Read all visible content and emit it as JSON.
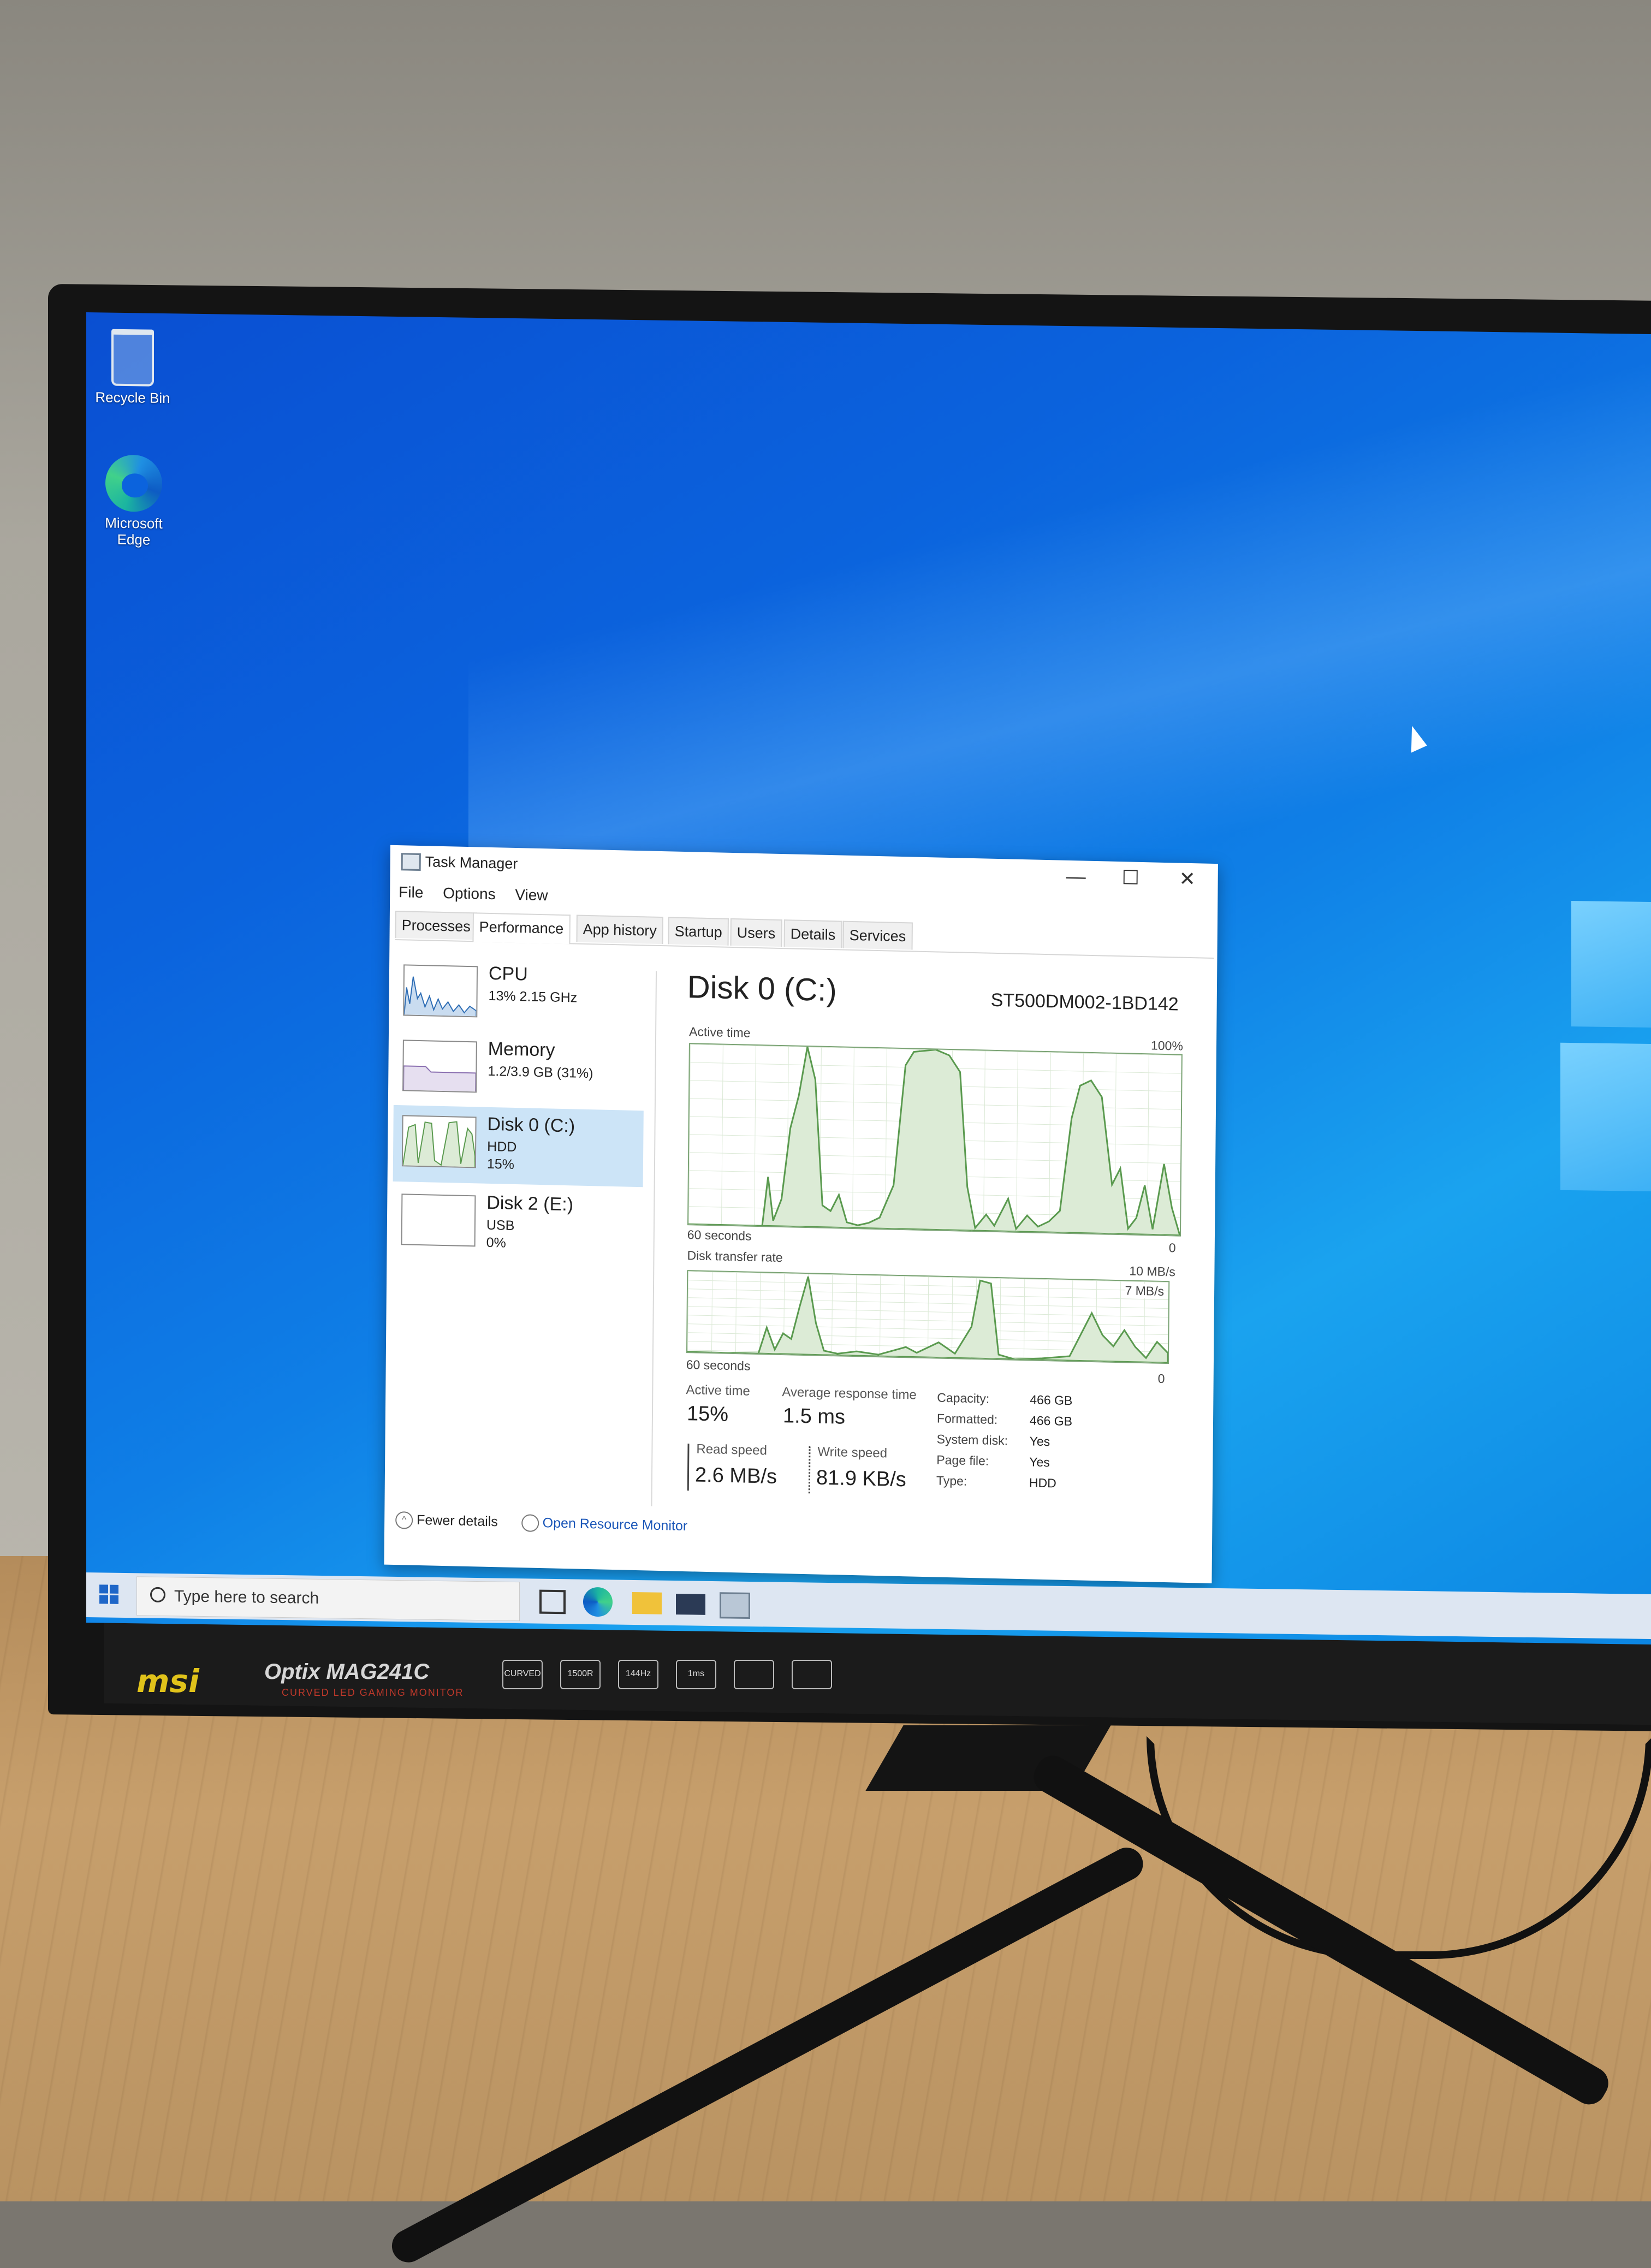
{
  "desktop": {
    "icons": [
      {
        "label": "Recycle Bin"
      },
      {
        "label": "Microsoft Edge"
      }
    ]
  },
  "task_manager": {
    "title": "Task Manager",
    "window_controls": {
      "minimize": "—",
      "maximize": "☐",
      "close": "✕"
    },
    "menu": [
      "File",
      "Options",
      "View"
    ],
    "tabs": [
      "Processes",
      "Performance",
      "App history",
      "Startup",
      "Users",
      "Details",
      "Services"
    ],
    "active_tab": "Performance",
    "sidebar": [
      {
        "name": "CPU",
        "line2": "13% 2.15 GHz",
        "line3": ""
      },
      {
        "name": "Memory",
        "line2": "1.2/3.9 GB (31%)",
        "line3": ""
      },
      {
        "name": "Disk 0 (C:)",
        "line2": "HDD",
        "line3": "15%"
      },
      {
        "name": "Disk 2 (E:)",
        "line2": "USB",
        "line3": "0%"
      }
    ],
    "detail": {
      "title": "Disk 0 (C:)",
      "model": "ST500DM002-1BD142",
      "graph1": {
        "label": "Active time",
        "max_label": "100%",
        "time_label": "60 seconds",
        "min_label": "0"
      },
      "graph2": {
        "label": "Disk transfer rate",
        "max_label": "10 MB/s",
        "inner_label": "7 MB/s",
        "time_label": "60 seconds",
        "min_label": "0"
      },
      "stats": {
        "active_time_label": "Active time",
        "active_time_value": "15%",
        "avg_response_label": "Average response time",
        "avg_response_value": "1.5 ms",
        "read_speed_label": "Read speed",
        "read_speed_value": "2.6 MB/s",
        "write_speed_label": "Write speed",
        "write_speed_value": "81.9 KB/s"
      },
      "properties": [
        {
          "key": "Capacity:",
          "value": "466 GB"
        },
        {
          "key": "Formatted:",
          "value": "466 GB"
        },
        {
          "key": "System disk:",
          "value": "Yes"
        },
        {
          "key": "Page file:",
          "value": "Yes"
        },
        {
          "key": "Type:",
          "value": "HDD"
        }
      ]
    },
    "footer": {
      "fewer_details": "Fewer details",
      "open_resource_monitor": "Open Resource Monitor"
    }
  },
  "taskbar": {
    "search_placeholder": "Type here to search",
    "icons": [
      "task-view-icon",
      "edge-icon",
      "file-explorer-icon",
      "mail-icon",
      "task-manager-icon"
    ]
  },
  "monitor": {
    "brand": "msi",
    "model": "Optix MAG241C",
    "model_sub": "CURVED LED GAMING MONITOR",
    "badges": [
      "CURVED",
      "1500R",
      "144Hz",
      "1ms",
      "",
      ""
    ]
  },
  "colors": {
    "accent": "#1e66c8",
    "selection": "#cce4f7",
    "graph_line": "#5a9a4f",
    "graph_fill": "#dcebd6"
  }
}
